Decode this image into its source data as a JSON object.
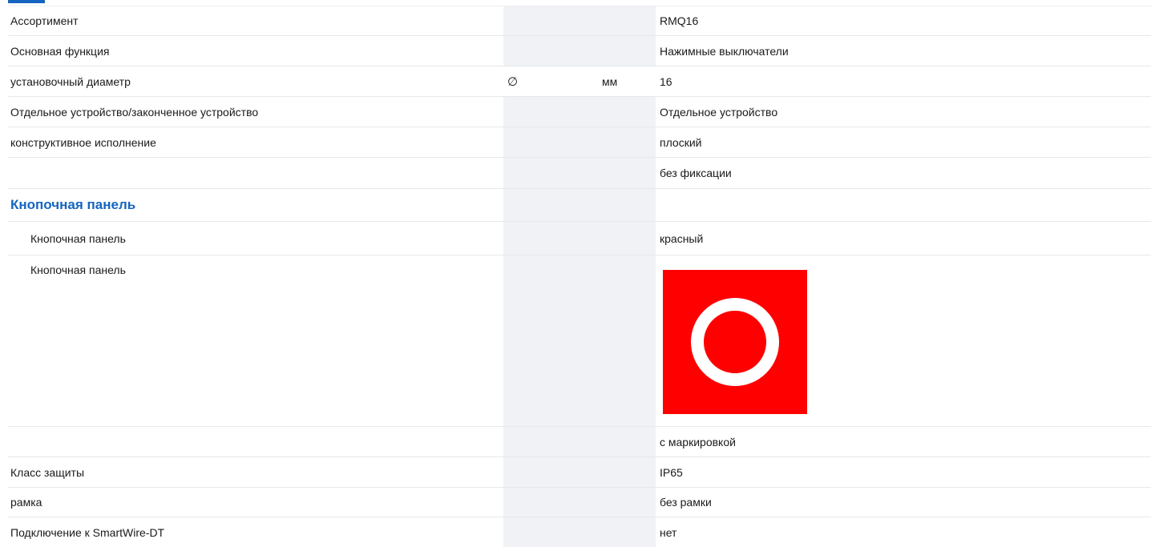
{
  "rows": [
    {
      "label": "Ассортимент",
      "symbol": "",
      "unit": "",
      "value": "RMQ16"
    },
    {
      "label": "Основная функция",
      "symbol": "",
      "unit": "",
      "value": "Нажимные выключатели"
    },
    {
      "label": "установочный диаметр",
      "symbol": "∅",
      "unit": "мм",
      "value": "16"
    },
    {
      "label": "Отдельное устройство/законченное устройство",
      "symbol": "",
      "unit": "",
      "value": "Отдельное устройство"
    },
    {
      "label": "конструктивное исполнение",
      "symbol": "",
      "unit": "",
      "value": "плоский"
    },
    {
      "label": "",
      "symbol": "",
      "unit": "",
      "value": "без фиксации"
    }
  ],
  "section": {
    "title": "Кнопочная панель",
    "rows": [
      {
        "label": "Кнопочная панель",
        "value": "красный"
      },
      {
        "label": "Кнопочная панель",
        "image": "red-button-circle-symbol"
      }
    ]
  },
  "rows_after": [
    {
      "label": "",
      "value": "с маркировкой"
    },
    {
      "label": "Класс защиты",
      "value": "IP65"
    },
    {
      "label": "рамка",
      "value": "без рамки"
    },
    {
      "label": "Подключение к SmartWire-DT",
      "value": "нет"
    }
  ],
  "colors": {
    "accent": "#1565c0",
    "swatch": "#ff0000",
    "column_band": "#f0f2f5"
  }
}
